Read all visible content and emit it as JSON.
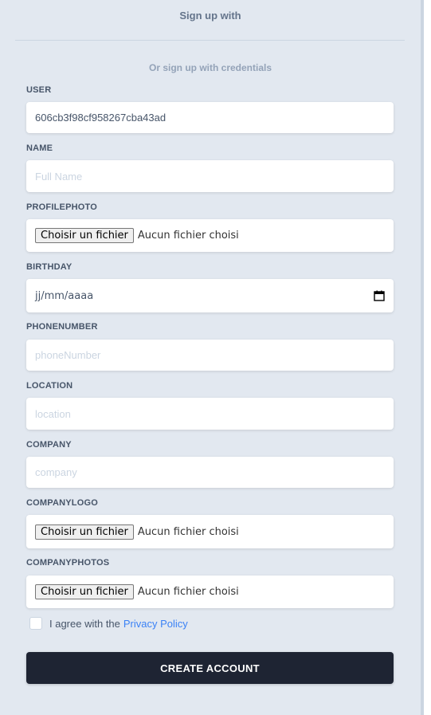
{
  "header": {
    "title": "Sign up with",
    "subtitle": "Or sign up with credentials"
  },
  "fields": {
    "user": {
      "label": "USER",
      "value": "606cb3f98cf958267cba43ad"
    },
    "name": {
      "label": "NAME",
      "placeholder": "Full Name"
    },
    "profilephoto": {
      "label": "PROFILEPHOTO",
      "button": "Choisir un fichier",
      "status": "Aucun fichier choisi"
    },
    "birthday": {
      "label": "BIRTHDAY",
      "value": "jj/mm/aaaa",
      "icon": "calendar-icon"
    },
    "phonenumber": {
      "label": "PHONENUMBER",
      "placeholder": "phoneNumber"
    },
    "location": {
      "label": "LOCATION",
      "placeholder": "location"
    },
    "company": {
      "label": "COMPANY",
      "placeholder": "company"
    },
    "companylogo": {
      "label": "COMPANYLOGO",
      "button": "Choisir un fichier",
      "status": "Aucun fichier choisi"
    },
    "companyphotos": {
      "label": "COMPANYPHOTOS",
      "button": "Choisir un fichier",
      "status": "Aucun fichier choisi"
    }
  },
  "agreement": {
    "text": "I agree with the",
    "link": "Privacy Policy",
    "checked": false
  },
  "submit": {
    "label": "CREATE ACCOUNT"
  },
  "colors": {
    "background": "#e2e8f0",
    "button": "#1e2433",
    "link": "#3b82f6"
  }
}
